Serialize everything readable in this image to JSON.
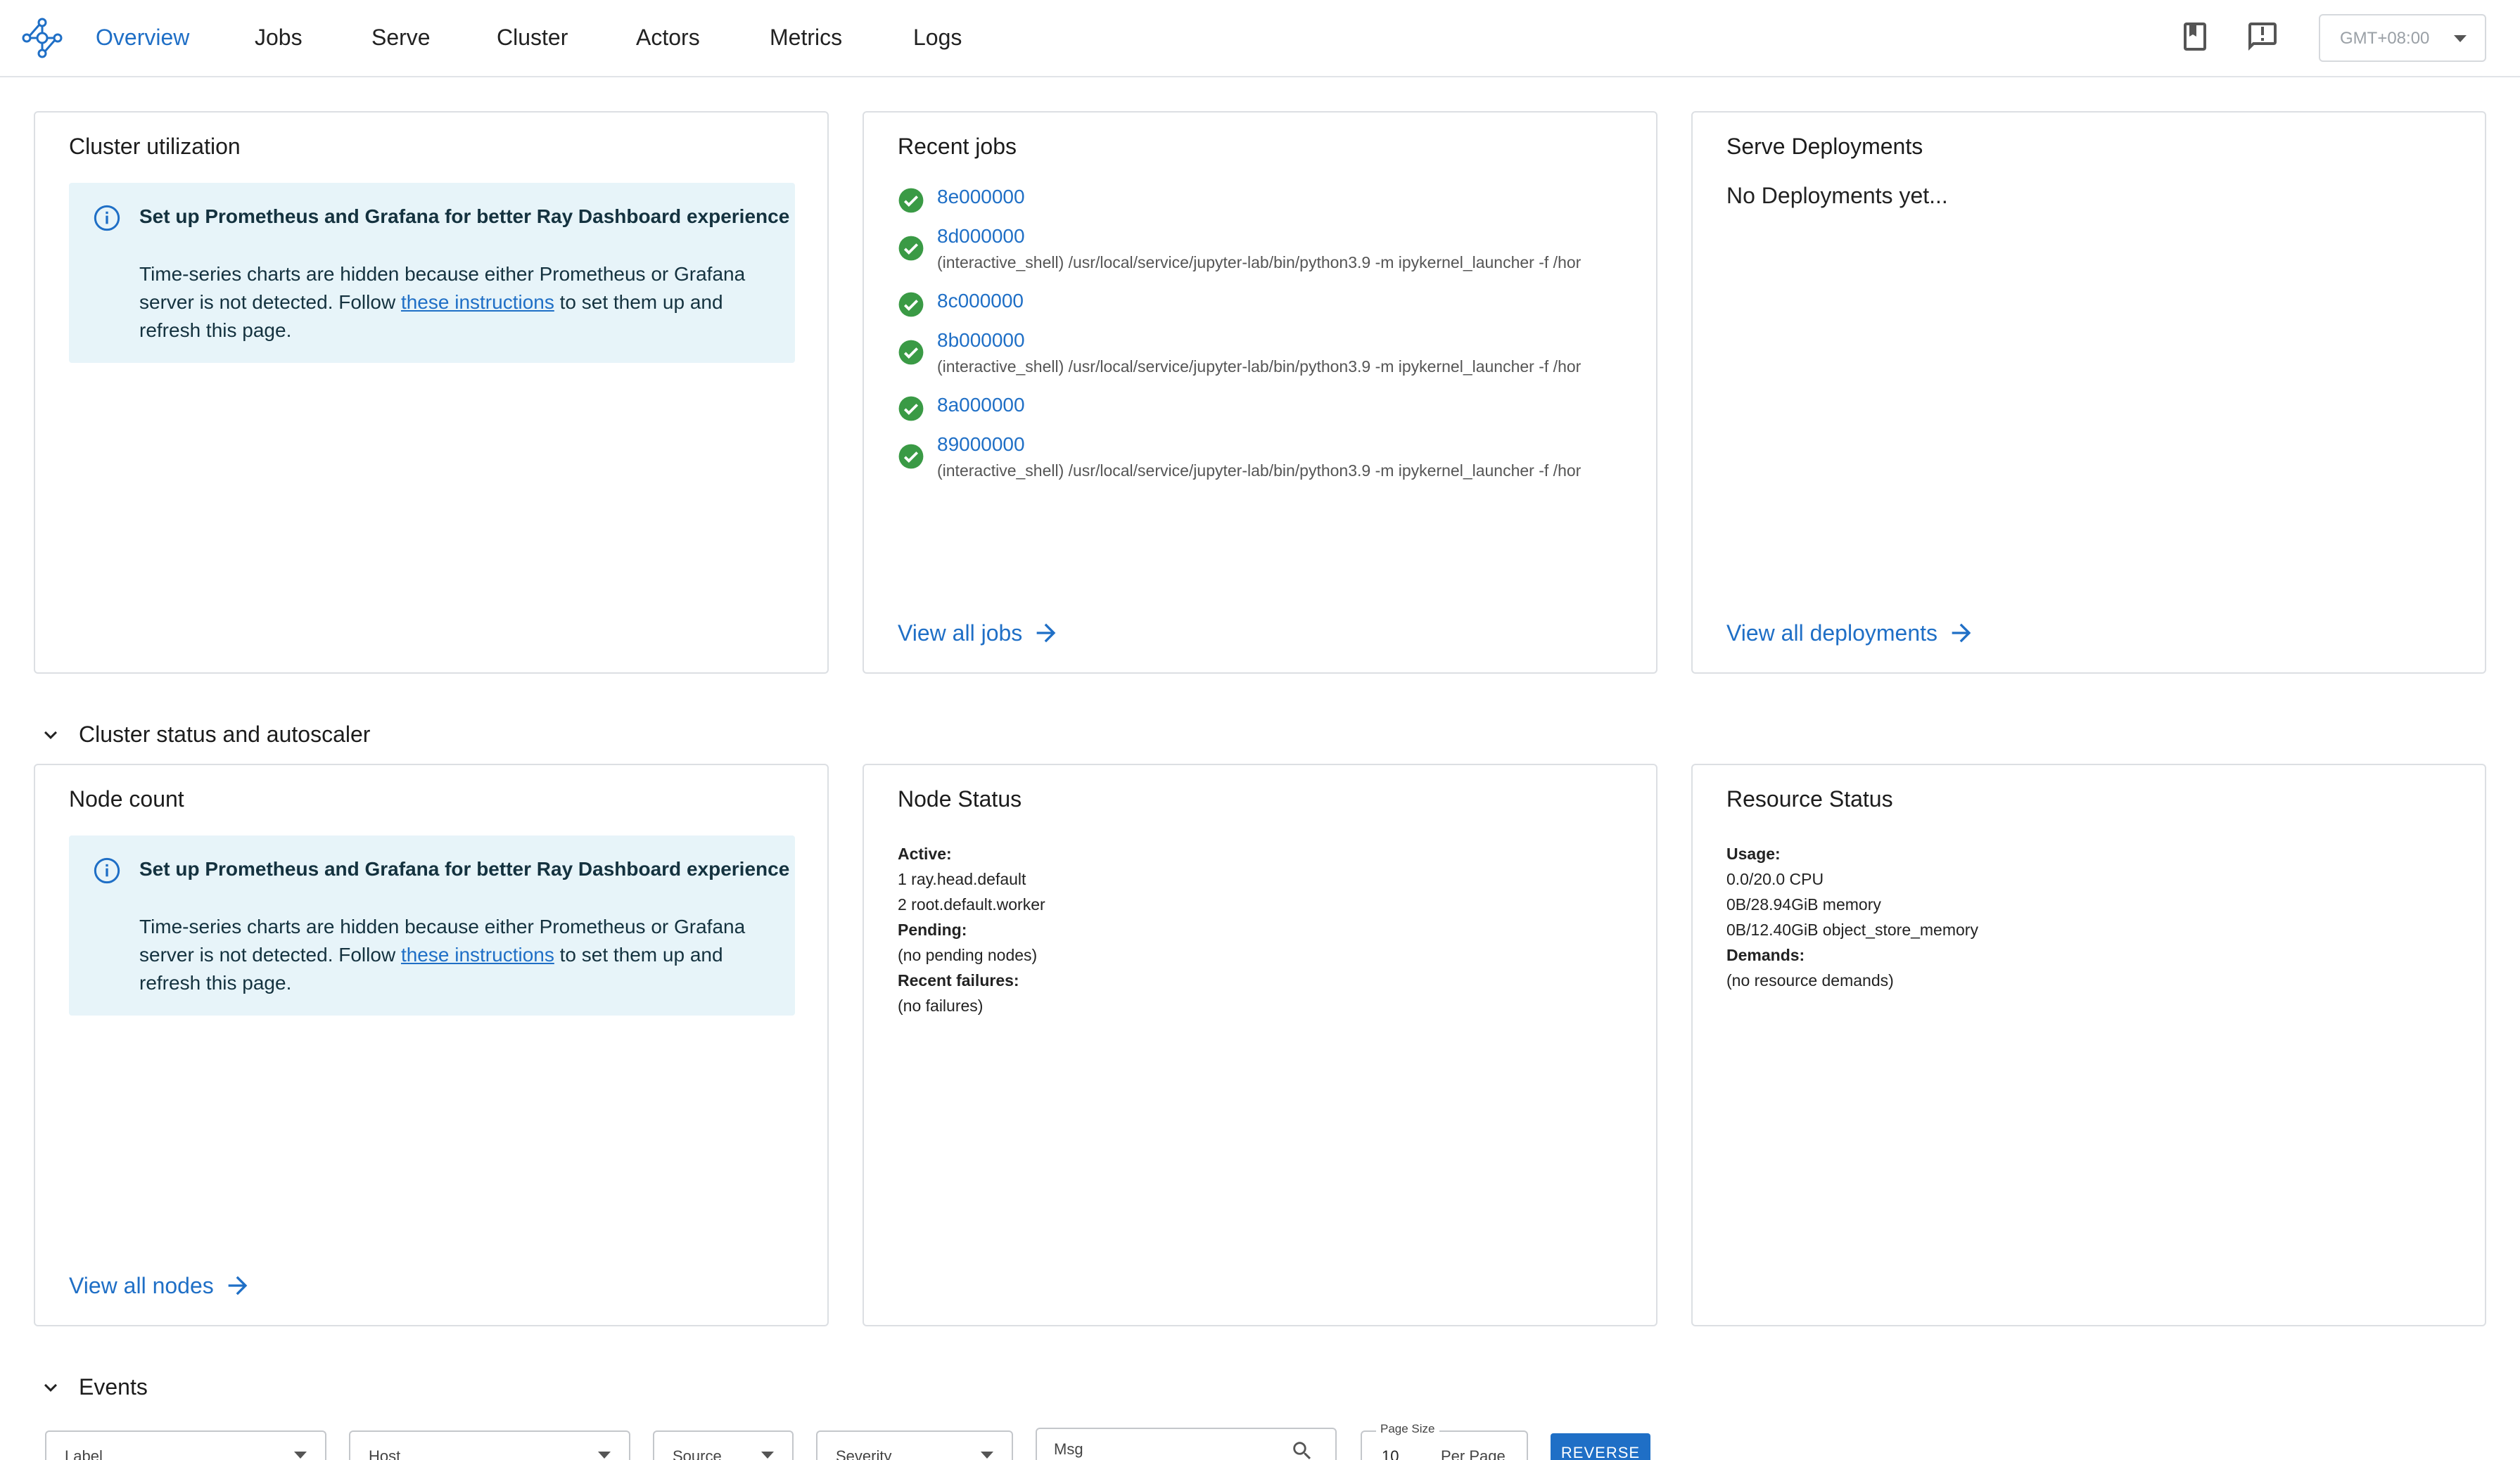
{
  "nav": {
    "items": [
      "Overview",
      "Jobs",
      "Serve",
      "Cluster",
      "Actors",
      "Metrics",
      "Logs"
    ],
    "active": "Overview",
    "timezone": "GMT+08:00"
  },
  "cluster_utilization": {
    "title": "Cluster utilization",
    "info_title": "Set up Prometheus and Grafana for better Ray Dashboard experience",
    "info_text_before": "Time-series charts are hidden because either Prometheus or Grafana server is not detected. Follow ",
    "info_link": "these instructions",
    "info_text_after": " to set them up and refresh this page."
  },
  "recent_jobs": {
    "title": "Recent jobs",
    "jobs": [
      {
        "id": "8e000000",
        "command": ""
      },
      {
        "id": "8d000000",
        "command": "(interactive_shell) /usr/local/service/jupyter-lab/bin/python3.9 -m ipykernel_launcher -f /hor"
      },
      {
        "id": "8c000000",
        "command": ""
      },
      {
        "id": "8b000000",
        "command": "(interactive_shell) /usr/local/service/jupyter-lab/bin/python3.9 -m ipykernel_launcher -f /hor"
      },
      {
        "id": "8a000000",
        "command": ""
      },
      {
        "id": "89000000",
        "command": "(interactive_shell) /usr/local/service/jupyter-lab/bin/python3.9 -m ipykernel_launcher -f /hor"
      }
    ],
    "view_all": "View all jobs"
  },
  "serve_deployments": {
    "title": "Serve Deployments",
    "empty": "No Deployments yet...",
    "view_all": "View all deployments"
  },
  "section_cluster_status": "Cluster status and autoscaler",
  "node_count": {
    "title": "Node count",
    "info_title": "Set up Prometheus and Grafana for better Ray Dashboard experience",
    "info_text_before": "Time-series charts are hidden because either Prometheus or Grafana server is not detected. Follow ",
    "info_link": "these instructions",
    "info_text_after": " to set them up and refresh this page.",
    "view_all": "View all nodes"
  },
  "node_status": {
    "title": "Node Status",
    "active_label": "Active:",
    "active": [
      "1 ray.head.default",
      "2 root.default.worker"
    ],
    "pending_label": "Pending:",
    "pending": "(no pending nodes)",
    "failures_label": "Recent failures:",
    "failures": "(no failures)"
  },
  "resource_status": {
    "title": "Resource Status",
    "usage_label": "Usage:",
    "usage": [
      "0.0/20.0 CPU",
      "0B/28.94GiB memory",
      "0B/12.40GiB object_store_memory"
    ],
    "demands_label": "Demands:",
    "demands": "(no resource demands)"
  },
  "section_events": "Events",
  "events_filters": {
    "label": "Label",
    "host": "Host",
    "source": "Source",
    "severity": "Severity",
    "msg_placeholder": "Msg",
    "page_size_label": "Page Size",
    "page_size": "10",
    "per_page": "Per Page",
    "reverse": "REVERSE"
  },
  "colors": {
    "accent": "#1f6fc6",
    "success": "#3a9a45",
    "info_bg": "#e7f4f9"
  },
  "icons": {
    "logo": "ray-logo-icon",
    "docs": "book-icon",
    "feedback": "feedback-icon"
  }
}
